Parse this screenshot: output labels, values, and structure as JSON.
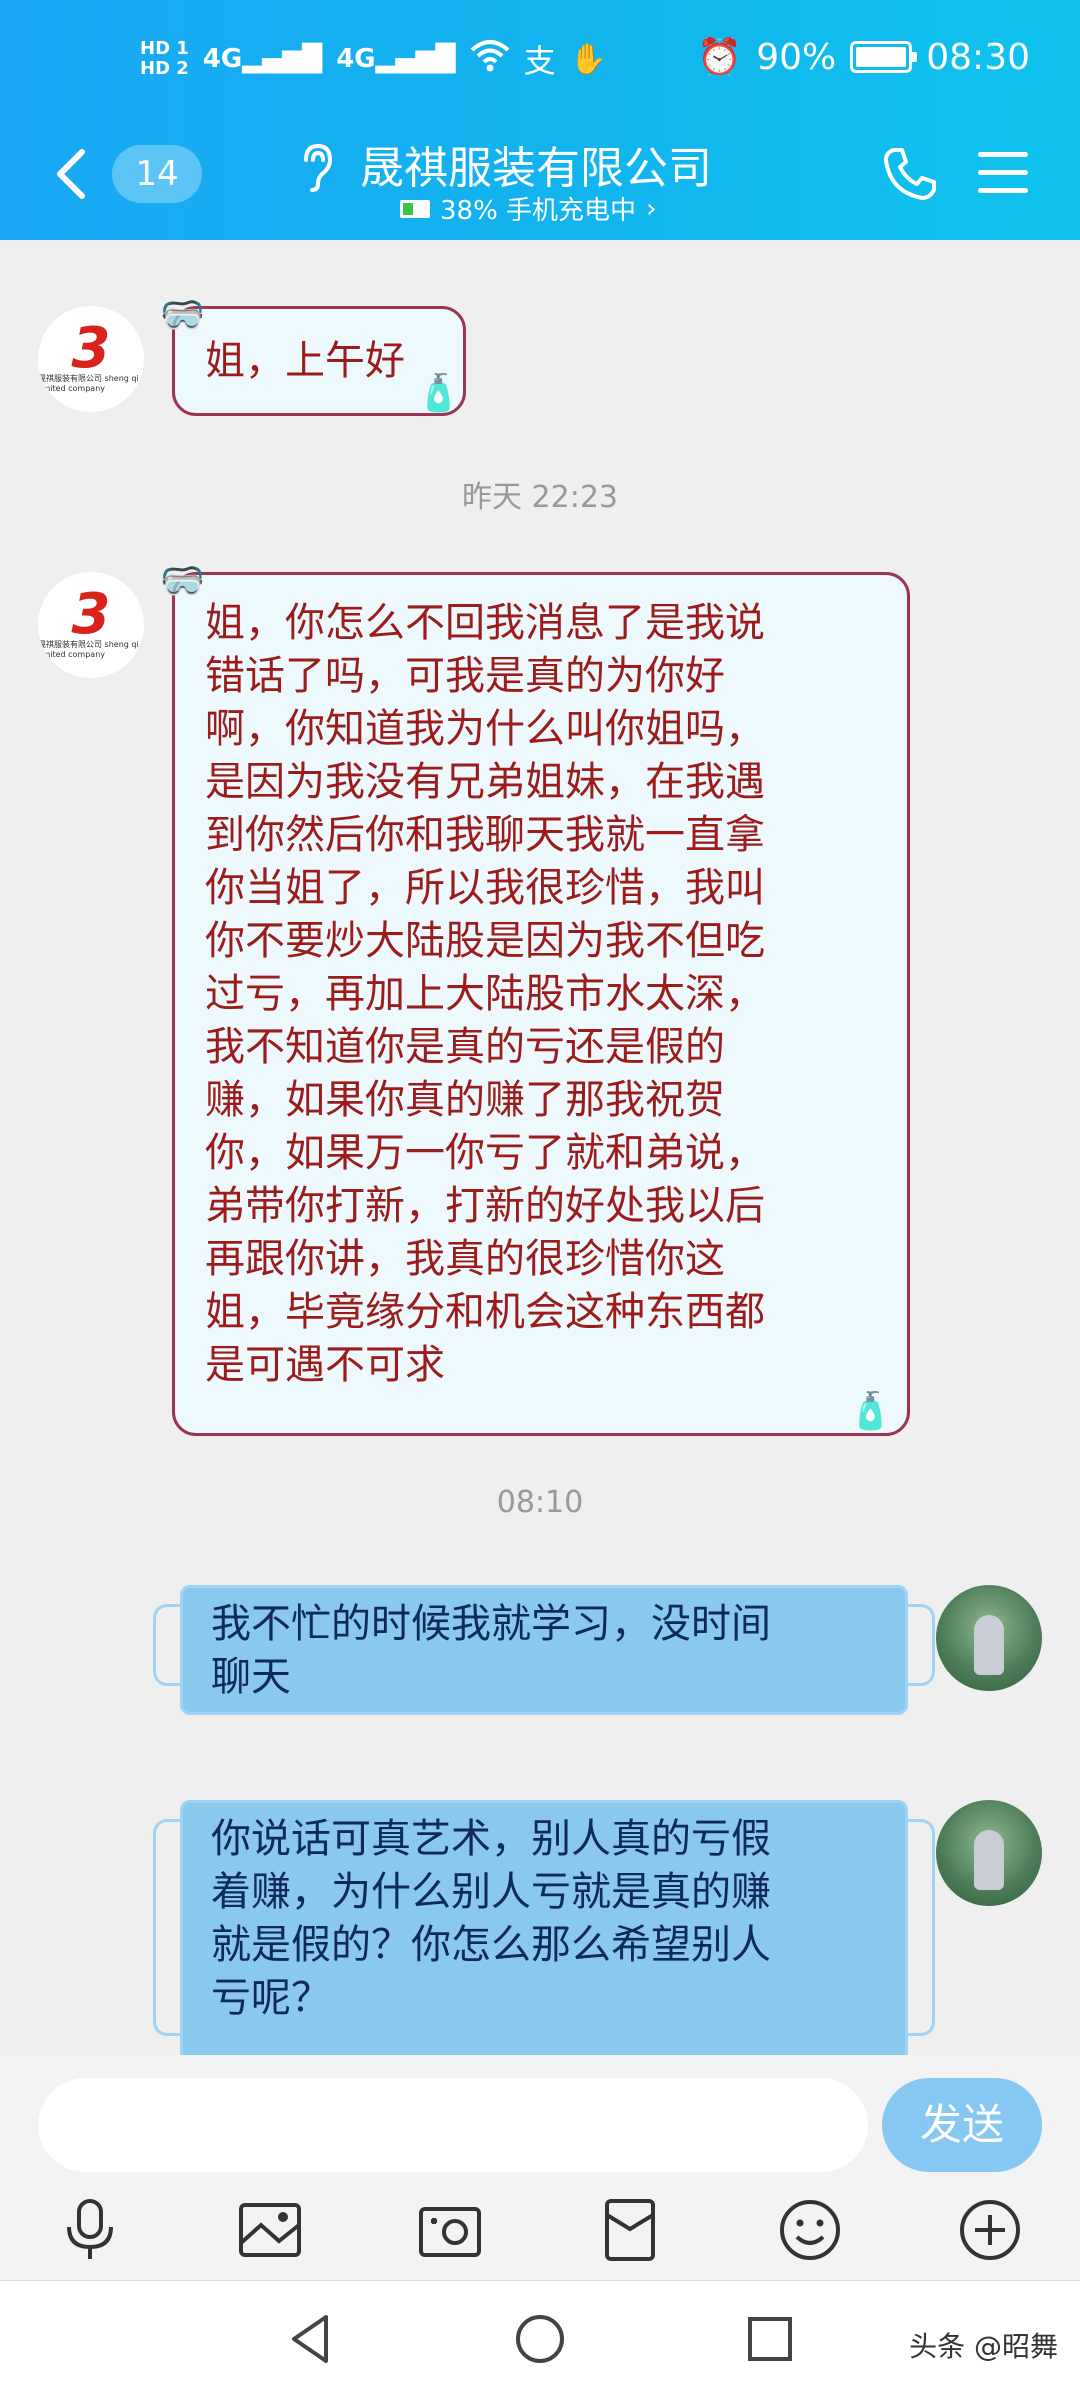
{
  "status_bar": {
    "hd_top": "HD 1",
    "hd_bottom": "HD 2",
    "signal1": "4G",
    "signal2": "4G",
    "battery_percent": "90%",
    "battery_level": 0.9,
    "time": "08:30"
  },
  "header": {
    "unread_count": "14",
    "title": "晟祺服装有限公司",
    "subtitle": "38% 手机充电中",
    "subtitle_chevron": "›"
  },
  "avatar_company_logo_text": "晟祺服装有限公司 sheng qi limited company",
  "messages": [
    {
      "side": "in",
      "text": "姐，上午好"
    },
    {
      "timestamp": "昨天 22:23"
    },
    {
      "side": "in",
      "text": "姐，你怎么不回我消息了是我说错话了吗，可我是真的为你好啊，你知道我为什么叫你姐吗，是因为我没有兄弟姐妹，在我遇到你然后你和我聊天我就一直拿你当姐了，所以我很珍惜，我叫你不要炒大陆股是因为我不但吃过亏，再加上大陆股市水太深，我不知道你是真的亏还是假的赚，如果你真的赚了那我祝贺你，如果万一你亏了就和弟说，弟带你打新，打新的好处我以后再跟你讲，我真的很珍惜你这姐，毕竟缘分和机会这种东西都是可遇不可求"
    },
    {
      "timestamp": "08:10"
    },
    {
      "side": "out",
      "text": "我不忙的时候我就学习，没时间聊天"
    },
    {
      "side": "out",
      "text": "你说话可真艺术，别人真的亏假着赚，为什么别人亏就是真的赚就是假的？你怎么那么希望别人亏呢？"
    }
  ],
  "msg1_lines": [
    "姐，上午好"
  ],
  "ts1": "昨天 22:23",
  "msg2_lines": [
    "姐，你怎么不回我消息了是我说",
    "错话了吗，可我是真的为你好",
    "啊，你知道我为什么叫你姐吗，",
    "是因为我没有兄弟姐妹，在我遇",
    "到你然后你和我聊天我就一直拿",
    "你当姐了，所以我很珍惜，我叫",
    "你不要炒大陆股是因为我不但吃",
    "过亏，再加上大陆股市水太深，",
    "我不知道你是真的亏还是假的",
    "赚，如果你真的赚了那我祝贺",
    "你，如果万一你亏了就和弟说，",
    "弟带你打新，打新的好处我以后",
    "再跟你讲，我真的很珍惜你这",
    "姐，毕竟缘分和机会这种东西都",
    "是可遇不可求"
  ],
  "ts2": "08:10",
  "msg3_lines": [
    "我不忙的时候我就学习，没时间",
    "聊天"
  ],
  "msg4_lines": [
    "你说话可真艺术，别人真的亏假",
    "着赚，为什么别人亏就是真的赚",
    "就是假的？你怎么那么希望别人",
    "亏呢？"
  ],
  "input": {
    "placeholder": "",
    "value": "",
    "send_label": "发送"
  },
  "toolbar_icons": [
    "microphone-icon",
    "image-icon",
    "camera-icon",
    "red-packet-icon",
    "emoji-icon",
    "plus-icon"
  ],
  "navbar": {
    "watermark": "头条 @昭舞"
  },
  "colors": {
    "header_blue": "#1aa8f5",
    "incoming_text": "#9c1c1c",
    "outgoing_bubble": "#8ac8ee",
    "send_button": "#86c8f2"
  }
}
